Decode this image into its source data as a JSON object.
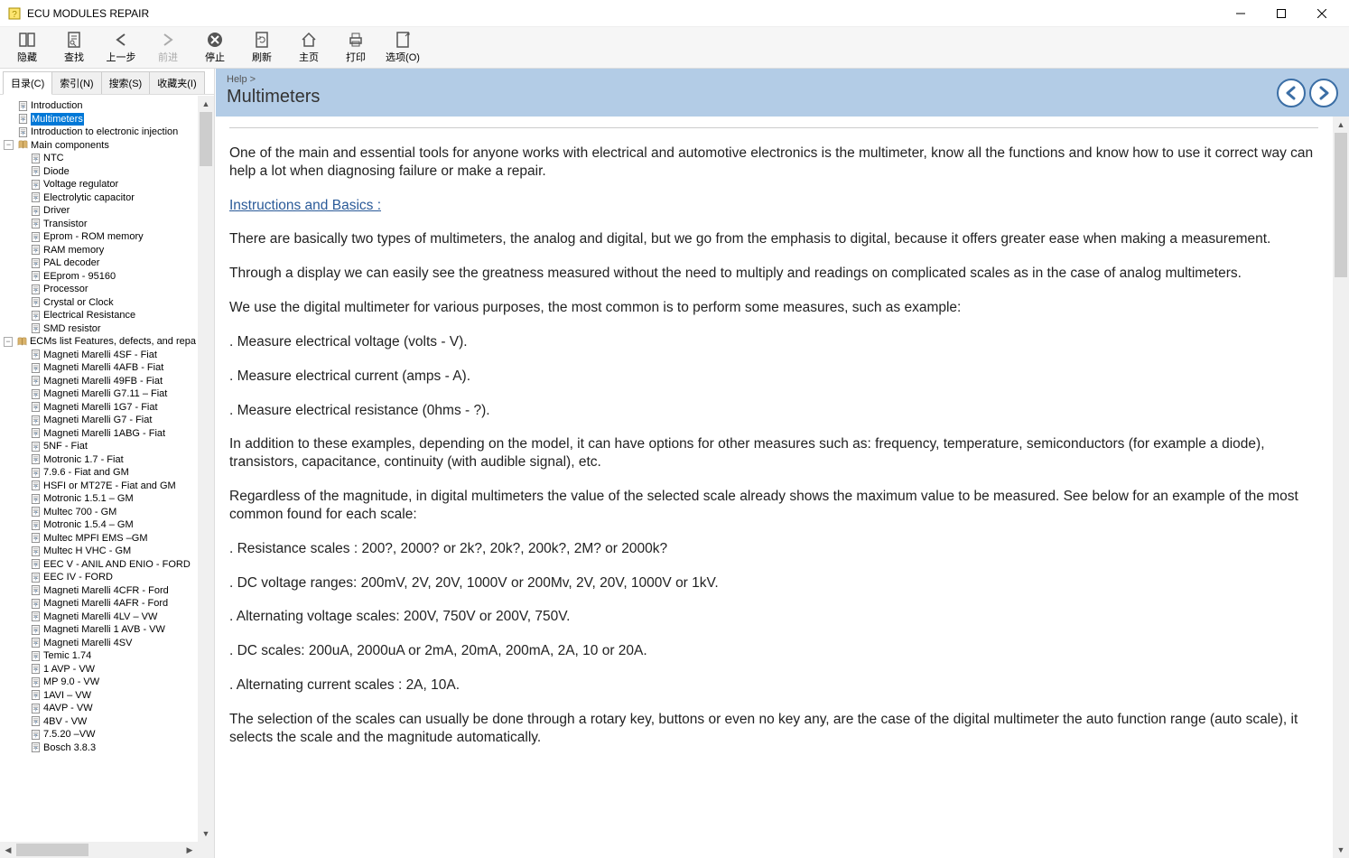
{
  "window": {
    "title": "ECU MODULES REPAIR"
  },
  "toolbar": [
    {
      "id": "hide",
      "label": "隐藏",
      "icon": "panel"
    },
    {
      "id": "find",
      "label": "查找",
      "icon": "find"
    },
    {
      "id": "back",
      "label": "上一步",
      "icon": "back"
    },
    {
      "id": "forward",
      "label": "前进",
      "icon": "forward",
      "disabled": true
    },
    {
      "id": "stop",
      "label": "停止",
      "icon": "stop"
    },
    {
      "id": "refresh",
      "label": "刷新",
      "icon": "refresh"
    },
    {
      "id": "home",
      "label": "主页",
      "icon": "home"
    },
    {
      "id": "print",
      "label": "打印",
      "icon": "print"
    },
    {
      "id": "options",
      "label": "选项(O)",
      "icon": "options"
    }
  ],
  "tabs": [
    {
      "id": "contents",
      "label": "目录(C)",
      "active": true
    },
    {
      "id": "index",
      "label": "索引(N)"
    },
    {
      "id": "search",
      "label": "搜索(S)"
    },
    {
      "id": "fav",
      "label": "收藏夹(I)"
    }
  ],
  "tree": [
    {
      "label": "Introduction",
      "kind": "doc"
    },
    {
      "label": "Multimeters",
      "kind": "doc",
      "selected": true
    },
    {
      "label": "Introduction to electronic injection",
      "kind": "doc"
    },
    {
      "label": "Main components",
      "kind": "book",
      "expanded": true,
      "children": [
        {
          "label": "NTC",
          "kind": "doc"
        },
        {
          "label": "Diode",
          "kind": "doc"
        },
        {
          "label": "Voltage regulator",
          "kind": "doc"
        },
        {
          "label": "Electrolytic capacitor",
          "kind": "doc"
        },
        {
          "label": "Driver",
          "kind": "doc"
        },
        {
          "label": "Transistor",
          "kind": "doc"
        },
        {
          "label": "Eprom - ROM memory",
          "kind": "doc"
        },
        {
          "label": "RAM memory",
          "kind": "doc"
        },
        {
          "label": "PAL decoder",
          "kind": "doc"
        },
        {
          "label": "EEprom - 95160",
          "kind": "doc"
        },
        {
          "label": "Processor",
          "kind": "doc"
        },
        {
          "label": "Crystal or Clock",
          "kind": "doc"
        },
        {
          "label": "Electrical Resistance",
          "kind": "doc"
        },
        {
          "label": "SMD resistor",
          "kind": "doc"
        }
      ]
    },
    {
      "label": "ECMs list Features, defects, and repa",
      "kind": "book",
      "expanded": true,
      "children": [
        {
          "label": "Magneti Marelli 4SF - Fiat",
          "kind": "doc"
        },
        {
          "label": "Magneti Marelli 4AFB - Fiat",
          "kind": "doc"
        },
        {
          "label": "Magneti Marelli 49FB - Fiat",
          "kind": "doc"
        },
        {
          "label": "Magneti Marelli G7.11 – Fiat",
          "kind": "doc"
        },
        {
          "label": "Magneti Marelli 1G7 - Fiat",
          "kind": "doc"
        },
        {
          "label": "Magneti Marelli G7 - Fiat",
          "kind": "doc"
        },
        {
          "label": "Magneti Marelli 1ABG - Fiat",
          "kind": "doc"
        },
        {
          "label": "5NF - Fiat",
          "kind": "doc"
        },
        {
          "label": "Motronic 1.7 - Fiat",
          "kind": "doc"
        },
        {
          "label": "7.9.6 - Fiat and GM",
          "kind": "doc"
        },
        {
          "label": "HSFI or MT27E - Fiat and GM",
          "kind": "doc"
        },
        {
          "label": "Motronic 1.5.1 – GM",
          "kind": "doc"
        },
        {
          "label": "Multec 700 - GM",
          "kind": "doc"
        },
        {
          "label": "Motronic 1.5.4 – GM",
          "kind": "doc"
        },
        {
          "label": "Multec MPFI EMS –GM",
          "kind": "doc"
        },
        {
          "label": "Multec H VHC - GM",
          "kind": "doc"
        },
        {
          "label": "EEC V - ANIL AND ENIO - FORD",
          "kind": "doc"
        },
        {
          "label": "EEC IV - FORD",
          "kind": "doc"
        },
        {
          "label": "Magneti Marelli 4CFR - Ford",
          "kind": "doc"
        },
        {
          "label": "Magneti Marelli 4AFR - Ford",
          "kind": "doc"
        },
        {
          "label": "Magneti Marelli 4LV – VW",
          "kind": "doc"
        },
        {
          "label": "Magneti Marelli 1 AVB - VW",
          "kind": "doc"
        },
        {
          "label": "Magneti Marelli 4SV",
          "kind": "doc"
        },
        {
          "label": "Temic 1.74",
          "kind": "doc"
        },
        {
          "label": "1 AVP - VW",
          "kind": "doc"
        },
        {
          "label": "MP 9.0 - VW",
          "kind": "doc"
        },
        {
          "label": "1AVI – VW",
          "kind": "doc"
        },
        {
          "label": "4AVP - VW",
          "kind": "doc"
        },
        {
          "label": "4BV - VW",
          "kind": "doc"
        },
        {
          "label": "7.5.20 –VW",
          "kind": "doc"
        },
        {
          "label": "Bosch 3.8.3",
          "kind": "doc"
        }
      ]
    }
  ],
  "page": {
    "breadcrumb": "Help >",
    "title": "Multimeters",
    "paragraphs": [
      {
        "text": "One of the main and essential tools for anyone works with electrical and automotive electronics is the multimeter, know all the functions and know how to use it correct way can help a lot when diagnosing failure or make a repair."
      },
      {
        "text": "Instructions and Basics :",
        "style": "sub"
      },
      {
        "text": "There are basically two types of multimeters, the analog and digital, but we go from the emphasis to digital, because it offers greater ease when making a measurement."
      },
      {
        "text": "Through a display we can easily see the greatness measured without the need to multiply and readings on complicated scales as in the case of analog multimeters."
      },
      {
        "text": "We use the digital multimeter for various purposes, the most common is to perform some measures, such as example:"
      },
      {
        "text": ". Measure electrical voltage (volts - V)."
      },
      {
        "text": ". Measure electrical current (amps - A)."
      },
      {
        "text": ". Measure electrical resistance (0hms - ?)."
      },
      {
        "text": "In addition to these examples, depending on the model, it can have options for other measures such as: frequency, temperature, semiconductors (for example a diode), transistors, capacitance, continuity (with audible signal), etc."
      },
      {
        "text": "Regardless of the magnitude, in digital multimeters the value of the selected scale already shows the maximum value to be measured. See below for an example of the most common found for each scale:"
      },
      {
        "text": ". Resistance scales : 200?, 2000? or 2k?, 20k?, 200k?, 2M? or 2000k?"
      },
      {
        "text": ". DC voltage ranges: 200mV, 2V, 20V, 1000V or 200Mv, 2V, 20V, 1000V or 1kV."
      },
      {
        "text": ". Alternating voltage scales: 200V, 750V or 200V, 750V."
      },
      {
        "text": ". DC scales: 200uA, 2000uA or 2mA, 20mA, 200mA, 2A, 10 or 20A."
      },
      {
        "text": ". Alternating current scales : 2A, 10A."
      },
      {
        "text": "The selection of the scales can usually be done through a rotary key, buttons or even no key any, are the case of the digital multimeter the auto function range (auto scale), it selects the scale and the magnitude automatically."
      }
    ]
  }
}
